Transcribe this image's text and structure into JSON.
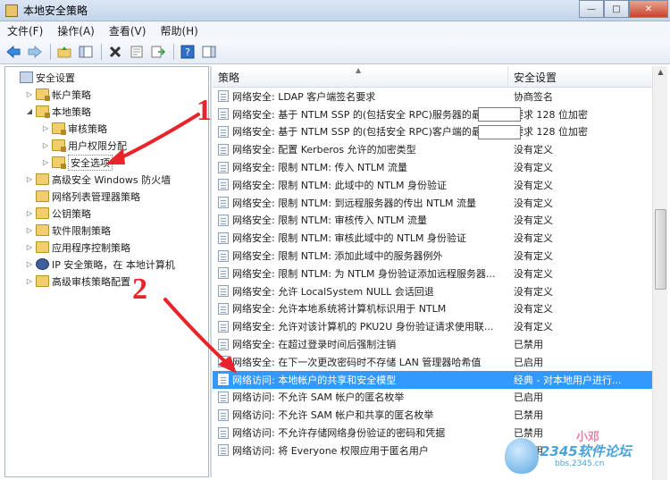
{
  "window": {
    "title": "本地安全策略",
    "controls": {
      "minimize": "—",
      "maximize": "□",
      "close": "✕"
    }
  },
  "menu": [
    "文件(F)",
    "操作(A)",
    "查看(V)",
    "帮助(H)"
  ],
  "toolbar_icons": [
    "back-arrow-icon",
    "forward-arrow-icon",
    "up-folder-icon",
    "show-hide-tree-icon",
    "delete-icon",
    "properties-icon",
    "export-list-icon",
    "help-icon",
    "action-pane-icon"
  ],
  "tree": {
    "items": [
      {
        "label": "安全设置",
        "level": 0,
        "expander": "",
        "icon": "root"
      },
      {
        "label": "帐户策略",
        "level": 1,
        "expander": "▷",
        "icon": "lockfolder"
      },
      {
        "label": "本地策略",
        "level": 1,
        "expander": "◢",
        "icon": "lockfolder"
      },
      {
        "label": "审核策略",
        "level": 2,
        "expander": "▷",
        "icon": "lockfolder"
      },
      {
        "label": "用户权限分配",
        "level": 2,
        "expander": "▷",
        "icon": "lockfolder"
      },
      {
        "label": "安全选项",
        "level": 2,
        "expander": "▷",
        "icon": "lockfolder",
        "selected": true
      },
      {
        "label": "高级安全 Windows 防火墙",
        "level": 1,
        "expander": "▷",
        "icon": "folder"
      },
      {
        "label": "网络列表管理器策略",
        "level": 1,
        "expander": "",
        "icon": "folder"
      },
      {
        "label": "公钥策略",
        "level": 1,
        "expander": "▷",
        "icon": "folder"
      },
      {
        "label": "软件限制策略",
        "level": 1,
        "expander": "▷",
        "icon": "folder"
      },
      {
        "label": "应用程序控制策略",
        "level": 1,
        "expander": "▷",
        "icon": "folder"
      },
      {
        "label": "IP 安全策略，在 本地计算机",
        "level": 1,
        "expander": "▷",
        "icon": "ipsec"
      },
      {
        "label": "高级审核策略配置",
        "level": 1,
        "expander": "▷",
        "icon": "folder"
      }
    ]
  },
  "list": {
    "headers": [
      "策略",
      "安全设置"
    ],
    "rows": [
      {
        "policy": "网络安全: LDAP 客户端签名要求",
        "setting": "协商签名"
      },
      {
        "policy": "网络安全: 基于 NTLM SSP 的(包括安全 RPC)服务器的最小...",
        "setting": "要求 128 位加密"
      },
      {
        "policy": "网络安全: 基于 NTLM SSP 的(包括安全 RPC)客户端的最小...",
        "setting": "要求 128 位加密"
      },
      {
        "policy": "网络安全: 配置 Kerberos 允许的加密类型",
        "setting": "没有定义"
      },
      {
        "policy": "网络安全: 限制 NTLM: 传入 NTLM 流量",
        "setting": "没有定义"
      },
      {
        "policy": "网络安全: 限制 NTLM: 此域中的 NTLM 身份验证",
        "setting": "没有定义"
      },
      {
        "policy": "网络安全: 限制 NTLM: 到远程服务器的传出 NTLM 流量",
        "setting": "没有定义"
      },
      {
        "policy": "网络安全: 限制 NTLM: 审核传入 NTLM 流量",
        "setting": "没有定义"
      },
      {
        "policy": "网络安全: 限制 NTLM: 审核此域中的 NTLM 身份验证",
        "setting": "没有定义"
      },
      {
        "policy": "网络安全: 限制 NTLM: 添加此域中的服务器例外",
        "setting": "没有定义"
      },
      {
        "policy": "网络安全: 限制 NTLM: 为 NTLM 身份验证添加远程服务器...",
        "setting": "没有定义"
      },
      {
        "policy": "网络安全: 允许 LocalSystem NULL 会话回退",
        "setting": "没有定义"
      },
      {
        "policy": "网络安全: 允许本地系统将计算机标识用于 NTLM",
        "setting": "没有定义"
      },
      {
        "policy": "网络安全: 允许对该计算机的 PKU2U 身份验证请求使用联...",
        "setting": "没有定义"
      },
      {
        "policy": "网络安全: 在超过登录时间后强制注销",
        "setting": "已禁用"
      },
      {
        "policy": "网络安全: 在下一次更改密码时不存储 LAN 管理器哈希值",
        "setting": "已启用"
      },
      {
        "policy": "网络访问: 本地帐户的共享和安全模型",
        "setting": "经典 - 对本地用户进行...",
        "selected": true
      },
      {
        "policy": "网络访问: 不允许 SAM 帐户的匿名枚举",
        "setting": "已启用"
      },
      {
        "policy": "网络访问: 不允许 SAM 帐户和共享的匿名枚举",
        "setting": "已禁用"
      },
      {
        "policy": "网络访问: 不允许存储网络身份验证的密码和凭据",
        "setting": "已禁用"
      },
      {
        "policy": "网络访问: 将 Everyone 权限应用于匿名用户",
        "setting": "已禁用"
      }
    ]
  },
  "annotations": {
    "one": "1",
    "two": "2"
  },
  "watermark": {
    "tag": "小邓",
    "main": "2345软件论坛",
    "url": "bbs.2345.cn"
  },
  "colors": {
    "selection": "#3399ff",
    "annotation_red": "#e8242a"
  }
}
